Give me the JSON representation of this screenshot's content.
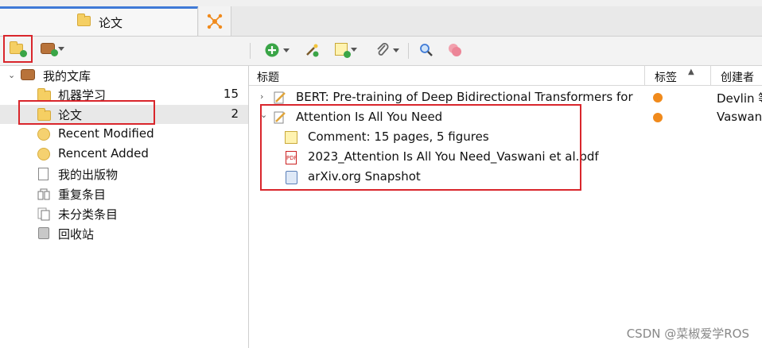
{
  "tabs": {
    "active_label": "论文"
  },
  "left": {
    "library": {
      "label": "我的文库"
    },
    "items": [
      {
        "label": "机器学习",
        "count": "15"
      },
      {
        "label": "论文",
        "count": "2"
      },
      {
        "label": "Recent Modified",
        "count": ""
      },
      {
        "label": "Rencent Added",
        "count": ""
      },
      {
        "label": "我的出版物",
        "count": ""
      },
      {
        "label": "重复条目",
        "count": ""
      },
      {
        "label": "未分类条目",
        "count": ""
      },
      {
        "label": "回收站",
        "count": ""
      }
    ]
  },
  "columns": {
    "title": "标题",
    "tags": "标签",
    "creator": "创建者"
  },
  "rows": [
    {
      "title": "BERT: Pre-training of Deep Bidirectional Transformers for ...",
      "creator": "Devlin 等"
    },
    {
      "title": "Attention Is All You Need",
      "creator": "Vaswani"
    }
  ],
  "children": [
    {
      "title": "Comment: 15 pages, 5 figures"
    },
    {
      "title": "2023_Attention Is All You Need_Vaswani et al.pdf"
    },
    {
      "title": "arXiv.org Snapshot"
    }
  ],
  "watermark": "CSDN @菜椒爱学ROS",
  "colors": {
    "accent": "#3f7ad6",
    "highlight": "#d9262c",
    "tag_dot": "#f08a1c"
  }
}
